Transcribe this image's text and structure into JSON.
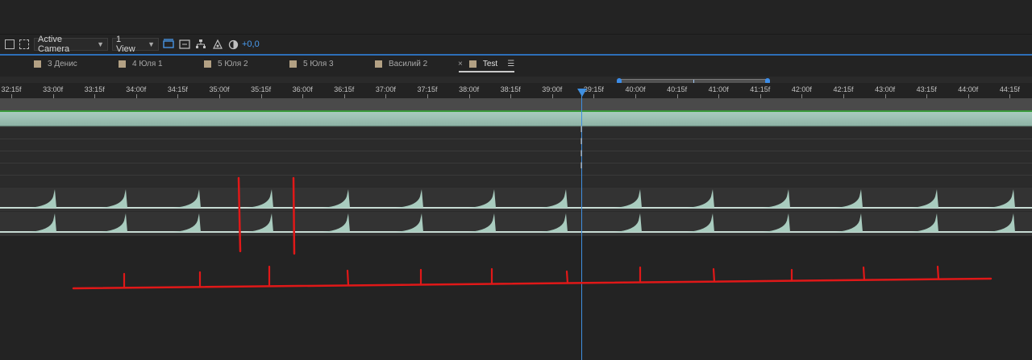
{
  "viewer": {
    "camera": "Active Camera",
    "views": "1 View",
    "exposure": "+0,0"
  },
  "tabs": [
    {
      "label": "3 Денис"
    },
    {
      "label": "4 Юля 1"
    },
    {
      "label": "5 Юля 2"
    },
    {
      "label": "5 Юля 3"
    },
    {
      "label": "Василий 2"
    },
    {
      "label": "Test",
      "active": true
    }
  ],
  "ruler": {
    "labels": [
      "32:15f",
      "33:00f",
      "33:15f",
      "34:00f",
      "34:15f",
      "35:00f",
      "35:15f",
      "36:00f",
      "36:15f",
      "37:00f",
      "37:15f",
      "38:00f",
      "38:15f",
      "39:00f",
      "39:15f",
      "40:00f",
      "40:15f",
      "41:00f",
      "41:15f",
      "42:00f",
      "42:15f",
      "43:00f",
      "43:15f",
      "44:00f",
      "44:15f"
    ]
  },
  "colors": {
    "accent": "#3f8fe0",
    "annotation": "#e01818",
    "audio_wave": "#a9ccbf"
  },
  "annotations": {
    "beat_marks": 13,
    "vertical_marks": 2
  }
}
